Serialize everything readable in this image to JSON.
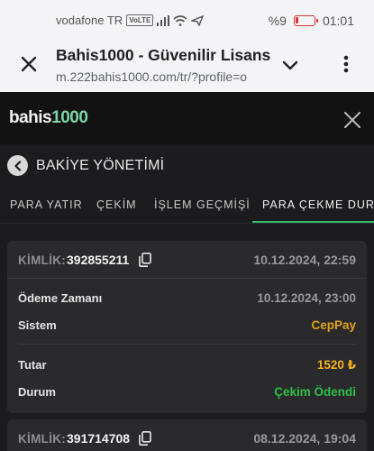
{
  "status_bar": {
    "carrier": "vodafone TR",
    "volte": "VoLTE",
    "battery": "%9",
    "time": "01:01",
    "colors": {
      "battery_low": "#dd3333"
    }
  },
  "browser_tab": {
    "title": "Bahis1000 - Güvenilir Lisans",
    "url": "m.222bahis1000.com/tr/?profile=o"
  },
  "site": {
    "logo_text_main": "bahis",
    "logo_text_accent": "1000"
  },
  "page": {
    "title": "BAKİYE YÖNETİMİ"
  },
  "tabs": [
    {
      "label": "PARA YATIR"
    },
    {
      "label": "ÇEKİM"
    },
    {
      "label": "İŞLEM GEÇMİŞİ"
    },
    {
      "label": "PARA ÇEKME DURUMU",
      "active": true
    }
  ],
  "transactions": [
    {
      "id_label": "KİMLİK:",
      "id": "392855211",
      "date": "10.12.2024, 22:59",
      "payment_time_label": "Ödeme Zamanı",
      "payment_time": "10.12.2024, 23:00",
      "system_label": "Sistem",
      "system": "CepPay",
      "amount_label": "Tutar",
      "amount": "1520 ₺",
      "status_label": "Durum",
      "status": "Çekim Ödendi"
    },
    {
      "id_label": "KİMLİK:",
      "id": "391714708",
      "date": "08.12.2024, 19:04"
    }
  ],
  "colors": {
    "accent_green": "#2fbf71",
    "status_paid": "#2fbf4a",
    "system_color": "#e0a21a",
    "amount_color": "#f5b21a"
  }
}
